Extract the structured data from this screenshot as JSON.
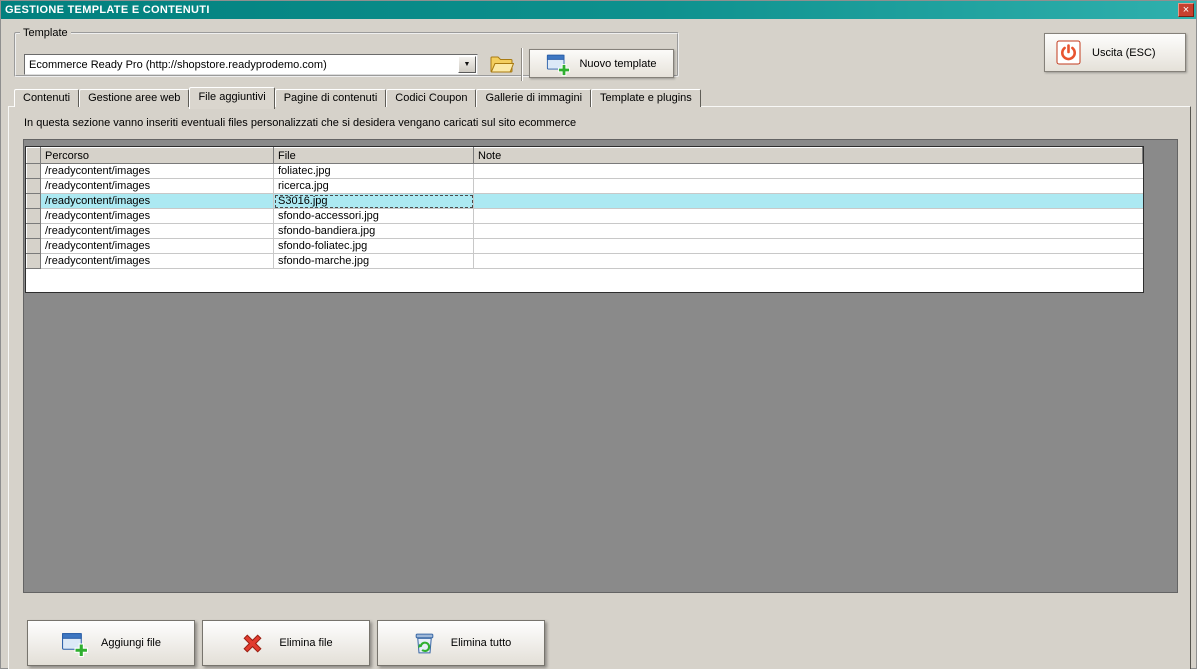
{
  "window": {
    "title": "GESTIONE TEMPLATE E CONTENUTI",
    "close_glyph": "×"
  },
  "icons": {
    "combo_arrow": "▼"
  },
  "template_section": {
    "group_label": "Template",
    "combo_value": "Ecommerce Ready Pro (http://shopstore.readyprodemo.com)",
    "new_template_label": "Nuovo template",
    "exit_label": "Uscita (ESC)"
  },
  "tabs": [
    {
      "label": "Contenuti",
      "active": false
    },
    {
      "label": "Gestione aree web",
      "active": false
    },
    {
      "label": "File aggiuntivi",
      "active": true
    },
    {
      "label": "Pagine di contenuti",
      "active": false
    },
    {
      "label": "Codici Coupon",
      "active": false
    },
    {
      "label": "Gallerie di immagini",
      "active": false
    },
    {
      "label": "Template e plugins",
      "active": false
    }
  ],
  "info_text": "In questa sezione vanno inseriti eventuali files personalizzati che si desidera vengano caricati sul sito ecommerce",
  "grid": {
    "columns": [
      "Percorso",
      "File",
      "Note"
    ],
    "selected_index": 2,
    "rows": [
      {
        "percorso": "/readycontent/images",
        "file": "foliatec.jpg",
        "note": ""
      },
      {
        "percorso": "/readycontent/images",
        "file": "ricerca.jpg",
        "note": ""
      },
      {
        "percorso": "/readycontent/images",
        "file": "S3016.jpg",
        "note": ""
      },
      {
        "percorso": "/readycontent/images",
        "file": "sfondo-accessori.jpg",
        "note": ""
      },
      {
        "percorso": "/readycontent/images",
        "file": "sfondo-bandiera.jpg",
        "note": ""
      },
      {
        "percorso": "/readycontent/images",
        "file": "sfondo-foliatec.jpg",
        "note": ""
      },
      {
        "percorso": "/readycontent/images",
        "file": "sfondo-marche.jpg",
        "note": ""
      }
    ]
  },
  "footer_buttons": [
    {
      "label": "Aggiungi file"
    },
    {
      "label": "Elimina file"
    },
    {
      "label": "Elimina tutto"
    }
  ],
  "colors": {
    "titlebar_teal": "#01807E",
    "selected_row": "#ACE9F2",
    "grid_panel_gray": "#8A8A8A",
    "window_bg": "#D6D2CA",
    "close_red": "#C8402E"
  }
}
